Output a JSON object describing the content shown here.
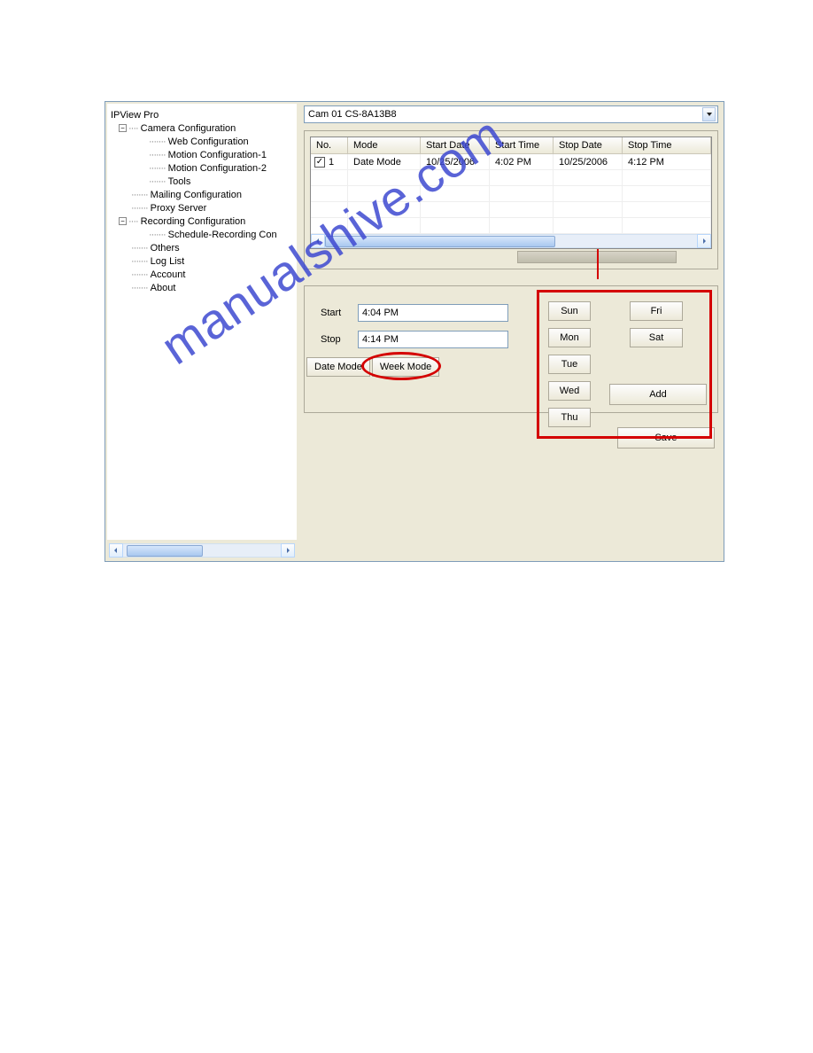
{
  "watermark": "manualshive.com",
  "tree": {
    "root": "IPView Pro",
    "camera_config": "Camera Configuration",
    "web_config": "Web Configuration",
    "motion1": "Motion Configuration-1",
    "motion2": "Motion Configuration-2",
    "tools": "Tools",
    "mailing": "Mailing Configuration",
    "proxy": "Proxy Server",
    "recording": "Recording Configuration",
    "schedule": "Schedule-Recording Con",
    "others": "Others",
    "loglist": "Log List",
    "account": "Account",
    "about": "About"
  },
  "combo": {
    "value": "Cam 01    CS-8A13B8"
  },
  "grid": {
    "headers": {
      "no": "No.",
      "mode": "Mode",
      "startdate": "Start Date",
      "starttime": "Start Time",
      "stopdate": "Stop Date",
      "stoptime": "Stop Time"
    },
    "rows": [
      {
        "checked": true,
        "no": "1",
        "mode": "Date Mode",
        "startdate": "10/25/2006",
        "starttime": "4:02 PM",
        "stopdate": "10/25/2006",
        "stoptime": "4:12 PM"
      }
    ]
  },
  "fields": {
    "start_label": "Start",
    "start_value": "4:04 PM",
    "stop_label": "Stop",
    "stop_value": "4:14 PM"
  },
  "days": {
    "sun": "Sun",
    "mon": "Mon",
    "tue": "Tue",
    "wed": "Wed",
    "thu": "Thu",
    "fri": "Fri",
    "sat": "Sat"
  },
  "modes": {
    "date": "Date Mode",
    "week": "Week Mode"
  },
  "buttons": {
    "add": "Add",
    "save": "Save"
  }
}
